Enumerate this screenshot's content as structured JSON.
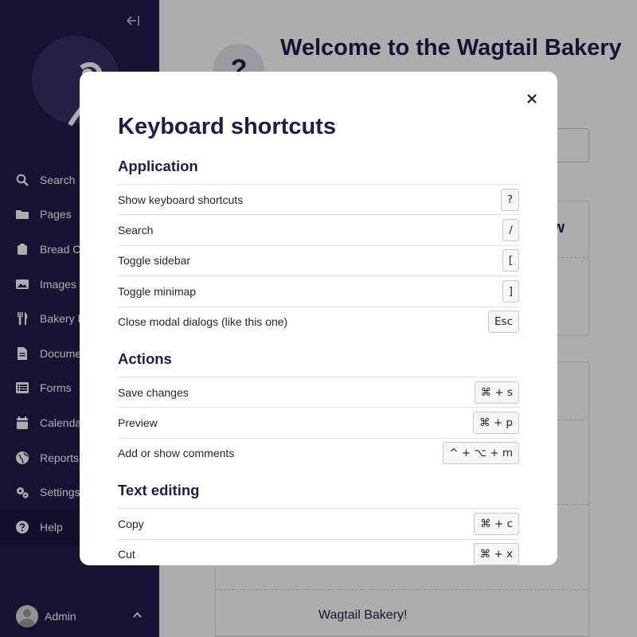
{
  "sidebar": {
    "collapse_icon": "collapse-left-icon",
    "search_label": "Search",
    "items": [
      {
        "label": "Pages",
        "icon": "folder-icon"
      },
      {
        "label": "Bread Categories",
        "icon": "clipboard-icon"
      },
      {
        "label": "Images",
        "icon": "image-icon"
      },
      {
        "label": "Bakery Misc",
        "icon": "utensils-icon"
      },
      {
        "label": "Documents",
        "icon": "document-icon"
      },
      {
        "label": "Forms",
        "icon": "list-icon"
      },
      {
        "label": "Calendar",
        "icon": "calendar-icon"
      },
      {
        "label": "Reports",
        "icon": "globe-icon"
      },
      {
        "label": "Settings",
        "icon": "cogs-icon"
      },
      {
        "label": "Help",
        "icon": "help-icon"
      }
    ],
    "account": {
      "name": "Admin"
    }
  },
  "main": {
    "title": "Welcome to the Wagtail Bakery",
    "panel_heading_partial": "w",
    "footer_text": "Wagtail Bakery!"
  },
  "modal": {
    "title": "Keyboard shortcuts",
    "close_label": "×",
    "sections": [
      {
        "title": "Application",
        "shortcuts": [
          {
            "label": "Show keyboard shortcuts",
            "keys": "?"
          },
          {
            "label": "Search",
            "keys": "/"
          },
          {
            "label": "Toggle sidebar",
            "keys": "["
          },
          {
            "label": "Toggle minimap",
            "keys": "]"
          },
          {
            "label": "Close modal dialogs (like this one)",
            "keys": "Esc"
          }
        ]
      },
      {
        "title": "Actions",
        "shortcuts": [
          {
            "label": "Save changes",
            "keys": "⌘ + s"
          },
          {
            "label": "Preview",
            "keys": "⌘ + p"
          },
          {
            "label": "Add or show comments",
            "keys": "^ + ⌥ + m"
          }
        ]
      },
      {
        "title": "Text editing",
        "shortcuts": [
          {
            "label": "Copy",
            "keys": "⌘ + c"
          },
          {
            "label": "Cut",
            "keys": "⌘ + x"
          }
        ]
      }
    ]
  },
  "colors": {
    "sidebar_bg": "#261a4b",
    "accent_text": "#261a4b",
    "overlay": "rgba(0,0,0,0.32)"
  }
}
